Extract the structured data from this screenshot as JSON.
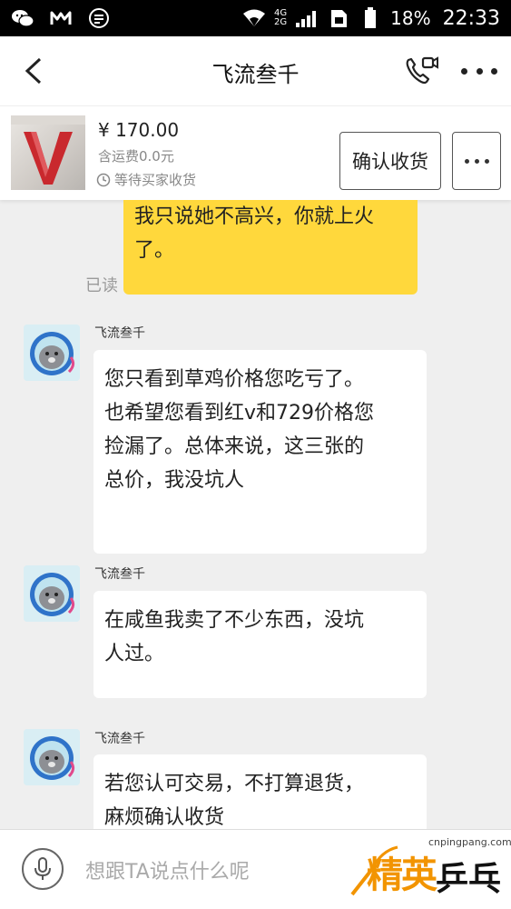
{
  "status_bar": {
    "network_top": "4G",
    "network_bottom": "2G",
    "battery": "18%",
    "time": "22:33"
  },
  "header": {
    "title": "飞流叁千"
  },
  "product": {
    "price": "¥ 170.00",
    "shipping": "含运费0.0元",
    "status": "等待买家收货",
    "confirm_label": "确认收货"
  },
  "messages": [
    {
      "direction": "out",
      "lines": [
        "我只说她不高兴，你就上火",
        "了。"
      ],
      "read_label": "已读"
    },
    {
      "direction": "in",
      "sender": "飞流叁千",
      "lines": [
        "您只看到草鸡价格您吃亏了。",
        "也希望您看到红v和729价格您",
        "捡漏了。总体来说，这三张的",
        "总价，我没坑人"
      ]
    },
    {
      "direction": "in",
      "sender": "飞流叁千",
      "lines": [
        "在咸鱼我卖了不少东西，没坑",
        "人过。"
      ]
    },
    {
      "direction": "in",
      "sender": "飞流叁千",
      "lines": [
        "若您认可交易，不打算退货，",
        "麻烦确认收货"
      ]
    }
  ],
  "input": {
    "placeholder": "想跟TA说点什么呢"
  },
  "watermark": {
    "url": "cnpingpang.com",
    "brand_left": "精英",
    "brand_right": "乒乓网"
  },
  "colors": {
    "outgoing_bubble": "#ffd83c",
    "incoming_bubble": "#ffffff",
    "background": "#efefef"
  }
}
